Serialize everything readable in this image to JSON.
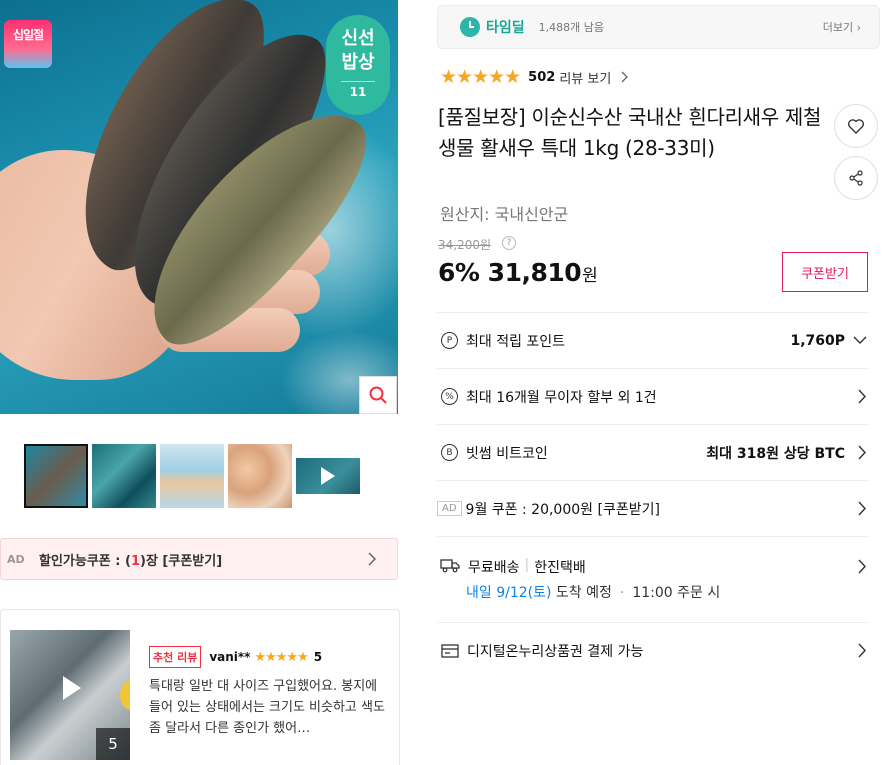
{
  "badges": {
    "event_badge": "십일절",
    "fresh_line1": "신선",
    "fresh_line2": "밥상",
    "fresh_logo": "11"
  },
  "coupon_bar": {
    "ad": "AD",
    "text_prefix": "할인가능쿠폰 : (",
    "count": "1",
    "text_suffix": ")장 [쿠폰받기]"
  },
  "review": {
    "tag": "추천 리뷰",
    "user": "vani**",
    "stars": "★★★★★",
    "score": "5",
    "text": "특대랑 일반 대 사이즈 구입했어요. 봉지에 들어 있는 상태에서는 크기도 비슷하고 색도 좀 달라서 다른 종인가 했어…",
    "media_count": "5"
  },
  "timedeal": {
    "label": "타임딜",
    "remain": "1,488개 남음",
    "more": "더보기 ›"
  },
  "rating": {
    "stars": "★★★★★",
    "value": 4.5,
    "count": "502",
    "link": "리뷰 보기"
  },
  "product": {
    "title": "[품질보장] 이순신수산 국내산 흰다리새우 제철 생물 활새우 특대 1kg (28-33미)",
    "origin": "원산지:  국내신안군",
    "original_price": "34,200원",
    "discount": "6%",
    "price": "31,810",
    "currency": "원",
    "coupon_button": "쿠폰받기"
  },
  "benefits": {
    "points": {
      "label": "최대 적립 포인트",
      "value": "1,760P"
    },
    "installment": {
      "label": "최대 16개월 무이자 할부 외 1건"
    },
    "bithumb": {
      "label": "빗썸 비트코인",
      "value": "최대 318원 상당 BTC"
    },
    "coupon": {
      "ad": "AD",
      "label": "9월 쿠폰 : 20,000원 [쿠폰받기]"
    },
    "shipping": {
      "label": "무료배송",
      "carrier": "한진택배",
      "date": "내일 9/12(토)",
      "date_suffix": " 도착 예정",
      "cutoff": "11:00 주문 시"
    },
    "payment": {
      "label": "디지털온누리상품권 결제 가능"
    }
  },
  "colors": {
    "accent_red": "#f43142",
    "coupon_pink": "#e01a5b",
    "timedeal_teal": "#1aa597",
    "star": "#f5a623",
    "link_blue": "#0b83e6"
  }
}
